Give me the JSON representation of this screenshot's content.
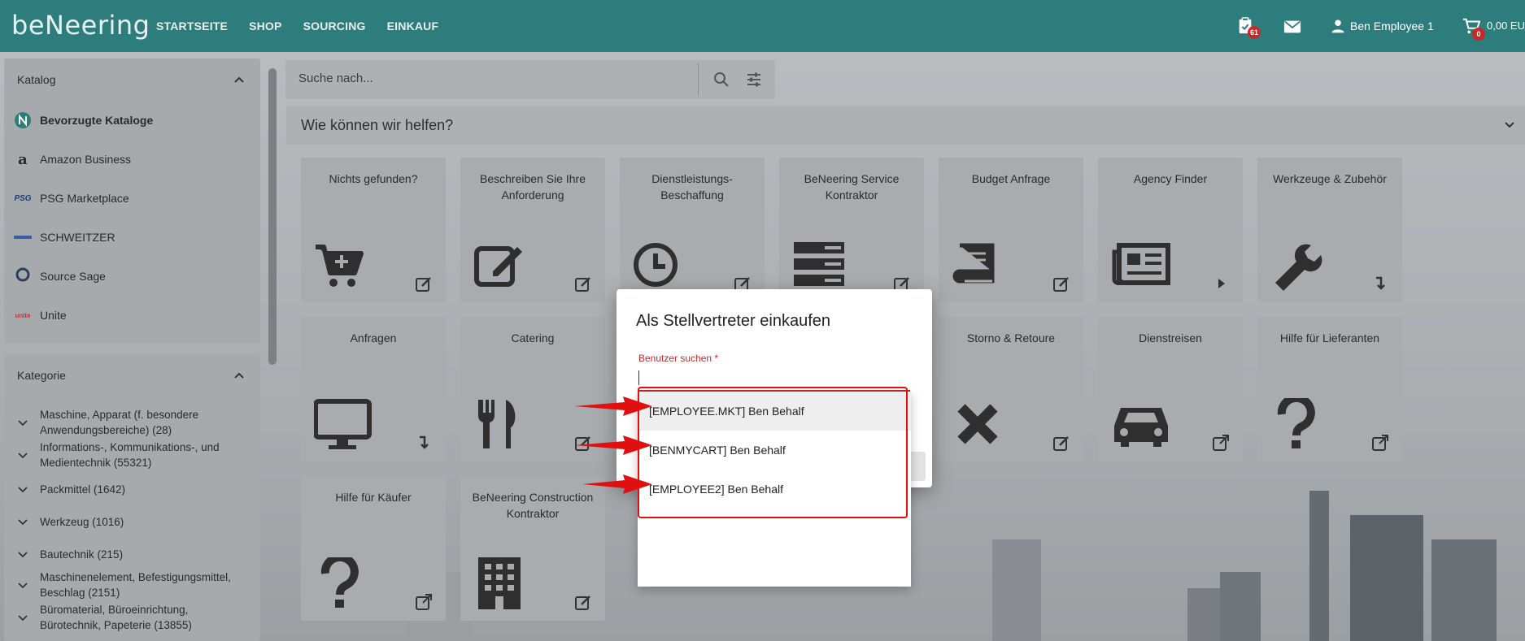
{
  "app": {
    "logo": "beNeering",
    "nav": [
      "STARTSEITE",
      "SHOP",
      "SOURCING",
      "EINKAUF"
    ],
    "tasks_badge": "61",
    "user_name": "Ben Employee 1",
    "cart_badge": "0",
    "cart_total": "0,00 EU"
  },
  "search": {
    "placeholder": "Suche nach..."
  },
  "sidebar": {
    "katalog_title": "Katalog",
    "catalogs": [
      {
        "label": "Bevorzugte Kataloge"
      },
      {
        "label": "Amazon Business"
      },
      {
        "label": "PSG Marketplace"
      },
      {
        "label": "SCHWEITZER"
      },
      {
        "label": "Source Sage"
      },
      {
        "label": "Unite"
      }
    ],
    "kategorie_title": "Kategorie",
    "categories": [
      {
        "label": "Maschine, Apparat (f. besondere Anwendungsbereiche) (28)"
      },
      {
        "label": "Informations-, Kommunikations-, und Medientechnik (55321)"
      },
      {
        "label": "Packmittel (1642)"
      },
      {
        "label": "Werkzeug (1016)"
      },
      {
        "label": "Bautechnik (215)"
      },
      {
        "label": "Maschinenelement, Befestigungsmittel, Beschlag (2151)"
      },
      {
        "label": "Büromaterial, Büroeinrichtung, Bürotechnik, Papeterie (13855)"
      }
    ]
  },
  "help": {
    "title": "Wie können wir helfen?",
    "tiles": [
      {
        "title": "Nichts gefunden?",
        "icon": "cart-plus-icon",
        "action": "edit-icon"
      },
      {
        "title": "Beschreiben Sie Ihre Anforderung",
        "icon": "pencil-square-icon",
        "action": "edit-icon"
      },
      {
        "title": "Dienstleistungs-Beschaffung",
        "icon": "clock-icon",
        "action": "edit-icon"
      },
      {
        "title": "BeNeering Service Kontraktor",
        "icon": "server-icon",
        "action": "edit-icon"
      },
      {
        "title": "Budget Anfrage",
        "icon": "book-icon",
        "action": "edit-icon"
      },
      {
        "title": "Agency Finder",
        "icon": "newspaper-icon",
        "action": "play-icon"
      },
      {
        "title": "Werkzeuge & Zubehör",
        "icon": "wrench-icon",
        "action": "arrow-down-icon"
      },
      {
        "title": "Anfragen",
        "icon": "monitor-icon",
        "action": "arrow-down-icon"
      },
      {
        "title": "Catering",
        "icon": "fork-knife-icon",
        "action": "edit-icon"
      },
      {
        "title": "Storno & Retoure",
        "icon": "x-icon",
        "action": "edit-icon"
      },
      {
        "title": "Dienstreisen",
        "icon": "car-icon",
        "action": "external-link-icon"
      },
      {
        "title": "Hilfe für Lieferanten",
        "icon": "question-icon",
        "action": "external-link-icon"
      },
      {
        "title": "Hilfe für Käufer",
        "icon": "question-icon",
        "action": "external-link-icon"
      },
      {
        "title": "BeNeering Construction Kontraktor",
        "icon": "building-icon",
        "action": "edit-icon"
      }
    ]
  },
  "dialog": {
    "title": "Als Stellvertreter einkaufen",
    "field_label": "Benutzer suchen",
    "required_mark": "*",
    "options": [
      {
        "label": "[EMPLOYEE.MKT] Ben Behalf"
      },
      {
        "label": "[BENMYCART] Ben Behalf"
      },
      {
        "label": "[EMPLOYEE2] Ben Behalf"
      }
    ]
  },
  "colors": {
    "header": "#2e7d7d",
    "annotation": "#e01010",
    "error": "#c62828"
  }
}
